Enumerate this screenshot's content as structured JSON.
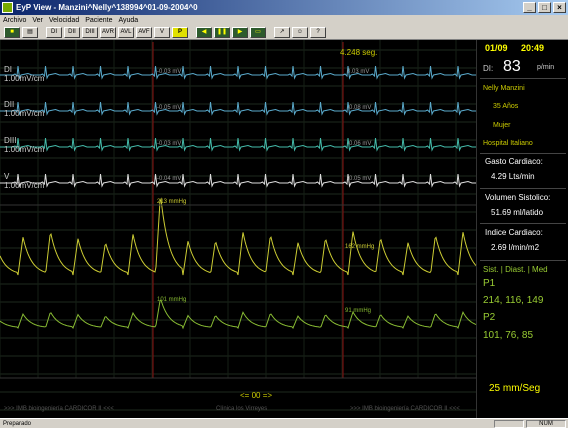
{
  "window": {
    "title": "EyP View - Manzini^Nelly^138994^01-09-2004^0",
    "minimize": "_",
    "maximize": "□",
    "close": "×"
  },
  "menu": [
    "Archivo",
    "Ver",
    "Velocidad",
    "Paciente",
    "Ayuda"
  ],
  "toolbar": {
    "buttons": [
      "DI",
      "DII",
      "DIII",
      "AVR",
      "AVL",
      "AVF",
      "V",
      "P"
    ]
  },
  "monitor": {
    "sweep_time": "4.248 seg.",
    "nav_label": "<= 00 =>",
    "footer_left": ">>> IMB bioingeniería CARDICOR II <<<",
    "footer_center": "Clínica los Virreyes",
    "footer_right": ">>> IMB bioingeniería CARDICOR II <<<",
    "leads": [
      {
        "name": "DI",
        "scale": "1.00mV/cm",
        "v1": "-0.03 mV",
        "v2": "0.03 mV",
        "color": "#5aaacc"
      },
      {
        "name": "DII",
        "scale": "1.00mV/cm",
        "v1": "-0.05 mV",
        "v2": "-0.08 mV",
        "color": "#5aaacc"
      },
      {
        "name": "DIII",
        "scale": "1.00mV/cm",
        "v1": "-0.03 mV",
        "v2": "-0.06 mV",
        "color": "#44bbaa"
      },
      {
        "name": "V",
        "scale": "1.00mV/cm",
        "v1": "-0.04 mV",
        "v2": "-0.05 mV",
        "color": "#dddddd"
      }
    ],
    "pressure": {
      "p1_peak1": "213 mmHg",
      "p1_peak2": "162 mmHg",
      "p1_color": "#cccc33",
      "p2_peak1": "101 mmHg",
      "p2_peak2": "91 mmHg",
      "p2_color": "#88bb33"
    }
  },
  "side": {
    "date": "01/09",
    "time": "20:49",
    "hr_label": "DI:",
    "hr_value": "83",
    "hr_unit": "p/min",
    "patient_name": "Nelly Manzini",
    "age": "35 Años",
    "sex": "Mujer",
    "hospital": "Hospital Italiano",
    "gasto_label": "Gasto Cardiaco:",
    "gasto_value": "4.29 Lts/min",
    "volumen_label": "Volumen Sistolico:",
    "volumen_value": "51.69 ml/latido",
    "indice_label": "Indice Cardiaco:",
    "indice_value": "2.69 l/min/m2",
    "press_header": "Sist. | Diast. | Med",
    "p1_label": "P1",
    "p1_values": "214, 116, 149",
    "p2_label": "P2",
    "p2_values": "101, 76, 85",
    "speed": "25 mm/Seg"
  },
  "statusbar": {
    "left": "Preparado",
    "num": "NUM"
  }
}
